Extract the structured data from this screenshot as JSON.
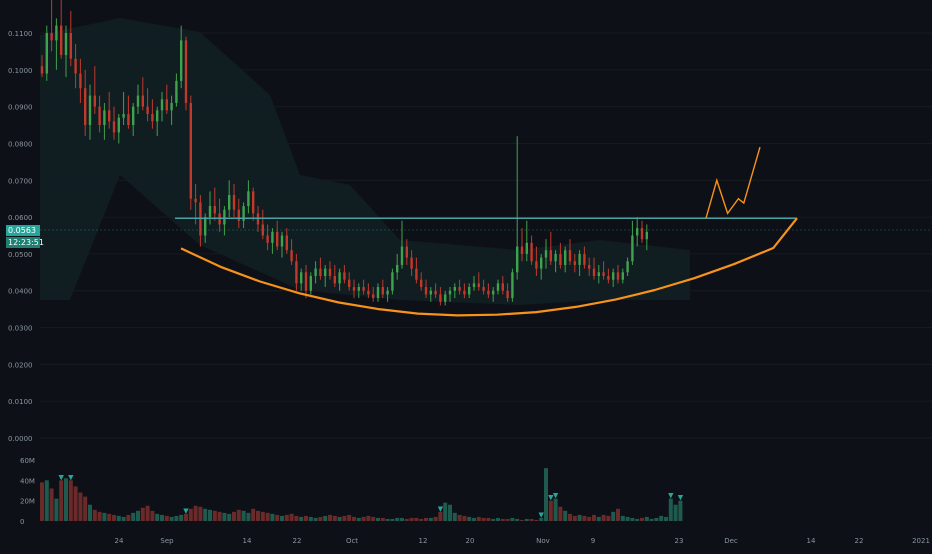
{
  "chart_data": {
    "type": "candlestick",
    "y_axis": {
      "ticks": [
        "0.1100",
        "0.1000",
        "0.0900",
        "0.0800",
        "0.0700",
        "0.0600",
        "0.0500",
        "0.0400",
        "0.0300",
        "0.0200",
        "0.0100",
        "0.0000"
      ],
      "values": [
        0.11,
        0.1,
        0.09,
        0.08,
        0.07,
        0.06,
        0.05,
        0.04,
        0.03,
        0.02,
        0.01,
        0.0
      ],
      "range": [
        0.0,
        0.12
      ]
    },
    "volume_axis": {
      "ticks": [
        "60M",
        "40M",
        "20M",
        "0"
      ],
      "values": [
        60,
        40,
        20,
        0
      ],
      "range": [
        0,
        70
      ]
    },
    "x_axis": {
      "ticks": [
        "24",
        "Sep",
        "14",
        "22",
        "Oct",
        "12",
        "20",
        "Nov",
        "9",
        "23",
        "Dec",
        "14",
        "22",
        "2021"
      ]
    },
    "last_price": {
      "value": "0.0563",
      "countdown": "12:23:51",
      "color": "#26a69a"
    },
    "resistance_level": 0.0597,
    "up_color": "#26a69a",
    "candle_up_color": "#3fa34d",
    "candle_down_color": "#c0392b",
    "cup_color": "#f7931a",
    "resistance_color": "#4aa3a3",
    "background": "#0d1117",
    "volume_series": [
      38,
      40,
      32,
      22,
      40,
      42,
      40,
      34,
      28,
      24,
      16,
      11,
      9,
      8,
      7,
      6,
      5,
      4,
      6,
      8,
      10,
      13,
      15,
      10,
      7,
      6,
      5,
      4,
      5,
      6,
      7,
      12,
      15,
      14,
      12,
      11,
      10,
      9,
      8,
      7,
      9,
      11,
      10,
      8,
      12,
      10,
      9,
      8,
      7,
      6,
      5,
      6,
      7,
      5,
      4,
      5,
      4,
      3,
      4,
      5,
      6,
      5,
      4,
      5,
      6,
      4,
      3,
      4,
      5,
      4,
      3,
      3,
      2,
      2,
      3,
      3,
      2,
      3,
      3,
      2,
      3,
      3,
      4,
      9,
      18,
      16,
      8,
      6,
      5,
      4,
      3,
      4,
      3,
      3,
      2,
      3,
      2,
      2,
      3,
      2,
      1,
      2,
      2,
      1,
      3,
      52,
      20,
      22,
      14,
      10,
      7,
      5,
      6,
      5,
      4,
      6,
      4,
      6,
      5,
      9,
      12,
      5,
      4,
      3,
      2,
      3,
      4,
      2,
      3,
      5,
      4,
      22,
      16,
      20
    ],
    "volume_markers": [
      {
        "index": 4,
        "label": "▼"
      },
      {
        "index": 6,
        "label": "▼"
      },
      {
        "index": 30,
        "label": "▼"
      },
      {
        "index": 83,
        "label": "▼"
      },
      {
        "index": 104,
        "label": "▼"
      },
      {
        "index": 106,
        "label": "▼"
      },
      {
        "index": 107,
        "label": "▼"
      },
      {
        "index": 131,
        "label": "▼"
      },
      {
        "index": 133,
        "label": "▼"
      }
    ],
    "candles": [
      [
        0.101,
        0.104,
        0.098,
        0.099
      ],
      [
        0.099,
        0.112,
        0.097,
        0.11
      ],
      [
        0.11,
        0.12,
        0.105,
        0.108
      ],
      [
        0.108,
        0.114,
        0.1,
        0.112
      ],
      [
        0.112,
        0.119,
        0.103,
        0.104
      ],
      [
        0.104,
        0.112,
        0.098,
        0.11
      ],
      [
        0.11,
        0.116,
        0.101,
        0.103
      ],
      [
        0.103,
        0.107,
        0.095,
        0.099
      ],
      [
        0.099,
        0.103,
        0.091,
        0.095
      ],
      [
        0.095,
        0.1,
        0.082,
        0.085
      ],
      [
        0.085,
        0.096,
        0.081,
        0.093
      ],
      [
        0.093,
        0.101,
        0.088,
        0.09
      ],
      [
        0.09,
        0.093,
        0.083,
        0.085
      ],
      [
        0.085,
        0.091,
        0.081,
        0.089
      ],
      [
        0.089,
        0.094,
        0.084,
        0.086
      ],
      [
        0.086,
        0.09,
        0.081,
        0.083
      ],
      [
        0.083,
        0.088,
        0.08,
        0.087
      ],
      [
        0.087,
        0.094,
        0.085,
        0.088
      ],
      [
        0.088,
        0.093,
        0.084,
        0.085
      ],
      [
        0.085,
        0.091,
        0.082,
        0.09
      ],
      [
        0.09,
        0.096,
        0.088,
        0.093
      ],
      [
        0.093,
        0.098,
        0.089,
        0.09
      ],
      [
        0.09,
        0.095,
        0.086,
        0.088
      ],
      [
        0.088,
        0.092,
        0.084,
        0.086
      ],
      [
        0.086,
        0.09,
        0.082,
        0.089
      ],
      [
        0.089,
        0.094,
        0.086,
        0.092
      ],
      [
        0.092,
        0.096,
        0.088,
        0.089
      ],
      [
        0.089,
        0.093,
        0.085,
        0.091
      ],
      [
        0.091,
        0.099,
        0.09,
        0.097
      ],
      [
        0.097,
        0.112,
        0.095,
        0.108
      ],
      [
        0.108,
        0.109,
        0.089,
        0.091
      ],
      [
        0.091,
        0.093,
        0.062,
        0.065
      ],
      [
        0.065,
        0.069,
        0.058,
        0.064
      ],
      [
        0.064,
        0.066,
        0.052,
        0.055
      ],
      [
        0.055,
        0.061,
        0.053,
        0.06
      ],
      [
        0.06,
        0.067,
        0.058,
        0.063
      ],
      [
        0.063,
        0.068,
        0.059,
        0.061
      ],
      [
        0.061,
        0.065,
        0.056,
        0.058
      ],
      [
        0.058,
        0.063,
        0.055,
        0.062
      ],
      [
        0.062,
        0.07,
        0.06,
        0.066
      ],
      [
        0.066,
        0.069,
        0.06,
        0.062
      ],
      [
        0.062,
        0.065,
        0.057,
        0.059
      ],
      [
        0.059,
        0.064,
        0.057,
        0.063
      ],
      [
        0.063,
        0.07,
        0.061,
        0.067
      ],
      [
        0.067,
        0.068,
        0.059,
        0.061
      ],
      [
        0.061,
        0.063,
        0.056,
        0.058
      ],
      [
        0.058,
        0.062,
        0.054,
        0.055
      ],
      [
        0.055,
        0.058,
        0.051,
        0.053
      ],
      [
        0.053,
        0.057,
        0.05,
        0.056
      ],
      [
        0.056,
        0.059,
        0.051,
        0.052
      ],
      [
        0.052,
        0.056,
        0.049,
        0.055
      ],
      [
        0.055,
        0.057,
        0.05,
        0.051
      ],
      [
        0.051,
        0.054,
        0.047,
        0.048
      ],
      [
        0.048,
        0.05,
        0.04,
        0.042
      ],
      [
        0.042,
        0.046,
        0.04,
        0.045
      ],
      [
        0.045,
        0.047,
        0.038,
        0.04
      ],
      [
        0.04,
        0.045,
        0.039,
        0.044
      ],
      [
        0.044,
        0.048,
        0.042,
        0.046
      ],
      [
        0.046,
        0.049,
        0.043,
        0.044
      ],
      [
        0.044,
        0.047,
        0.041,
        0.046
      ],
      [
        0.046,
        0.048,
        0.043,
        0.044
      ],
      [
        0.044,
        0.047,
        0.041,
        0.042
      ],
      [
        0.042,
        0.046,
        0.04,
        0.045
      ],
      [
        0.045,
        0.047,
        0.042,
        0.043
      ],
      [
        0.043,
        0.045,
        0.04,
        0.041
      ],
      [
        0.041,
        0.043,
        0.038,
        0.04
      ],
      [
        0.04,
        0.042,
        0.038,
        0.041
      ],
      [
        0.041,
        0.043,
        0.039,
        0.04
      ],
      [
        0.04,
        0.042,
        0.038,
        0.039
      ],
      [
        0.039,
        0.041,
        0.037,
        0.038
      ],
      [
        0.038,
        0.042,
        0.037,
        0.041
      ],
      [
        0.041,
        0.043,
        0.038,
        0.039
      ],
      [
        0.039,
        0.041,
        0.037,
        0.04
      ],
      [
        0.04,
        0.046,
        0.039,
        0.045
      ],
      [
        0.045,
        0.05,
        0.043,
        0.047
      ],
      [
        0.047,
        0.059,
        0.046,
        0.052
      ],
      [
        0.052,
        0.054,
        0.047,
        0.049
      ],
      [
        0.049,
        0.051,
        0.044,
        0.046
      ],
      [
        0.046,
        0.049,
        0.042,
        0.043
      ],
      [
        0.043,
        0.045,
        0.04,
        0.041
      ],
      [
        0.041,
        0.043,
        0.038,
        0.039
      ],
      [
        0.039,
        0.041,
        0.037,
        0.04
      ],
      [
        0.04,
        0.042,
        0.038,
        0.039
      ],
      [
        0.039,
        0.041,
        0.036,
        0.037
      ],
      [
        0.037,
        0.04,
        0.036,
        0.039
      ],
      [
        0.039,
        0.041,
        0.037,
        0.04
      ],
      [
        0.04,
        0.042,
        0.038,
        0.041
      ],
      [
        0.041,
        0.043,
        0.039,
        0.04
      ],
      [
        0.04,
        0.042,
        0.038,
        0.039
      ],
      [
        0.039,
        0.042,
        0.038,
        0.041
      ],
      [
        0.041,
        0.044,
        0.04,
        0.042
      ],
      [
        0.042,
        0.045,
        0.04,
        0.041
      ],
      [
        0.041,
        0.043,
        0.039,
        0.04
      ],
      [
        0.04,
        0.042,
        0.038,
        0.039
      ],
      [
        0.039,
        0.041,
        0.037,
        0.04
      ],
      [
        0.04,
        0.043,
        0.039,
        0.042
      ],
      [
        0.042,
        0.044,
        0.039,
        0.04
      ],
      [
        0.04,
        0.042,
        0.037,
        0.038
      ],
      [
        0.038,
        0.046,
        0.037,
        0.045
      ],
      [
        0.045,
        0.082,
        0.043,
        0.052
      ],
      [
        0.052,
        0.057,
        0.048,
        0.05
      ],
      [
        0.05,
        0.059,
        0.048,
        0.053
      ],
      [
        0.053,
        0.055,
        0.047,
        0.048
      ],
      [
        0.048,
        0.052,
        0.044,
        0.046
      ],
      [
        0.046,
        0.05,
        0.043,
        0.049
      ],
      [
        0.049,
        0.054,
        0.046,
        0.051
      ],
      [
        0.051,
        0.056,
        0.047,
        0.048
      ],
      [
        0.048,
        0.051,
        0.045,
        0.05
      ],
      [
        0.05,
        0.053,
        0.046,
        0.047
      ],
      [
        0.047,
        0.052,
        0.045,
        0.051
      ],
      [
        0.051,
        0.054,
        0.047,
        0.048
      ],
      [
        0.048,
        0.05,
        0.045,
        0.047
      ],
      [
        0.047,
        0.051,
        0.044,
        0.05
      ],
      [
        0.05,
        0.052,
        0.046,
        0.047
      ],
      [
        0.047,
        0.049,
        0.044,
        0.046
      ],
      [
        0.046,
        0.049,
        0.043,
        0.044
      ],
      [
        0.044,
        0.047,
        0.042,
        0.045
      ],
      [
        0.045,
        0.048,
        0.043,
        0.044
      ],
      [
        0.044,
        0.046,
        0.042,
        0.043
      ],
      [
        0.043,
        0.046,
        0.041,
        0.045
      ],
      [
        0.045,
        0.047,
        0.042,
        0.043
      ],
      [
        0.043,
        0.046,
        0.042,
        0.045
      ],
      [
        0.045,
        0.049,
        0.044,
        0.048
      ],
      [
        0.048,
        0.059,
        0.047,
        0.055
      ],
      [
        0.055,
        0.06,
        0.052,
        0.057
      ],
      [
        0.057,
        0.059,
        0.053,
        0.054
      ],
      [
        0.054,
        0.058,
        0.051,
        0.056
      ]
    ],
    "cup_curve": [
      [
        0,
        0.0515
      ],
      [
        10,
        0.0465
      ],
      [
        20,
        0.0425
      ],
      [
        30,
        0.0393
      ],
      [
        40,
        0.0368
      ],
      [
        50,
        0.035
      ],
      [
        60,
        0.0338
      ],
      [
        70,
        0.0333
      ],
      [
        80,
        0.0335
      ],
      [
        90,
        0.0342
      ],
      [
        100,
        0.0356
      ],
      [
        110,
        0.0376
      ],
      [
        120,
        0.0402
      ],
      [
        130,
        0.0434
      ],
      [
        140,
        0.0472
      ],
      [
        150,
        0.0516
      ],
      [
        156,
        0.0597
      ]
    ],
    "projection": [
      [
        130,
        0.0597
      ],
      [
        132,
        0.07
      ],
      [
        134,
        0.061
      ],
      [
        136,
        0.065
      ],
      [
        137,
        0.0638
      ],
      [
        140,
        0.079
      ]
    ]
  }
}
